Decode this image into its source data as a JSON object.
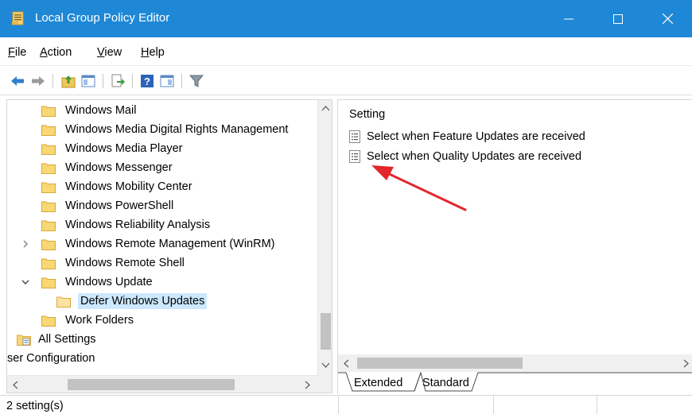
{
  "window": {
    "title": "Local Group Policy Editor",
    "accent": "#1e88d6"
  },
  "menu": [
    {
      "accel": "F",
      "rest": "ile"
    },
    {
      "accel": "A",
      "rest": "ction"
    },
    {
      "accel": "V",
      "rest": "iew"
    },
    {
      "accel": "H",
      "rest": "elp"
    }
  ],
  "toolbar": {
    "icons": [
      "back-icon",
      "forward-icon",
      "up-folder-icon",
      "show-hide-tree-icon",
      "export-list-icon",
      "help-icon",
      "properties-pane-icon",
      "filter-icon"
    ]
  },
  "tree": {
    "items": [
      {
        "label": "Windows Mail"
      },
      {
        "label": "Windows Media Digital Rights Management"
      },
      {
        "label": "Windows Media Player"
      },
      {
        "label": "Windows Messenger"
      },
      {
        "label": "Windows Mobility Center"
      },
      {
        "label": "Windows PowerShell"
      },
      {
        "label": "Windows Reliability Analysis"
      },
      {
        "label": "Windows Remote Management (WinRM)"
      },
      {
        "label": "Windows Remote Shell"
      },
      {
        "label": "Windows Update"
      },
      {
        "label": "Defer Windows Updates"
      },
      {
        "label": "Work Folders"
      },
      {
        "label": "All Settings"
      },
      {
        "label": "ser Configuration"
      }
    ]
  },
  "details": {
    "column_header": "Setting",
    "settings": [
      {
        "label": "Select when Feature Updates are received"
      },
      {
        "label": "Select when Quality Updates are received"
      }
    ],
    "tabs": [
      {
        "label": "Extended"
      },
      {
        "label": "Standard"
      }
    ]
  },
  "status": {
    "text": "2 setting(s)"
  }
}
